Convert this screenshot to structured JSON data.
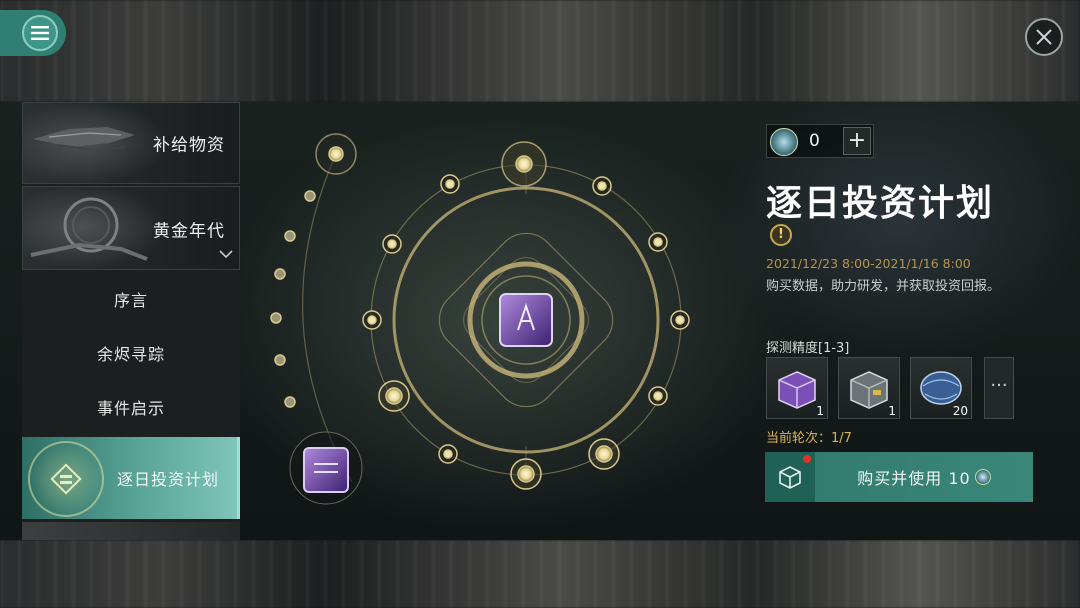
{
  "topbar": {
    "menu_icon": "hamburger-icon",
    "close_icon": "close-icon"
  },
  "sidebar": {
    "cards": [
      {
        "label": "补给物资"
      },
      {
        "label": "黄金年代",
        "expanded_icon": "chevron-down-icon"
      }
    ],
    "sub_items": [
      {
        "label": "序言"
      },
      {
        "label": "余烬寻踪"
      },
      {
        "label": "事件启示"
      },
      {
        "label": "逐日投资计划",
        "active": true
      }
    ]
  },
  "event": {
    "currency_count": "0",
    "title": "逐日投资计划",
    "date_range": "2021/12/23 8:00-2021/1/16 8:00",
    "description": "购买数据，助力研发，并获取投资回报。",
    "precision_label": "探测精度[1-3]",
    "rewards": [
      {
        "icon": "purple-crate-icon",
        "count": "1"
      },
      {
        "icon": "steel-crate-icon",
        "count": "1"
      },
      {
        "icon": "blue-orb-icon",
        "count": "20"
      }
    ],
    "more_label": "···",
    "round_label": "当前轮次：1/7",
    "buy_label": "购买并使用 10"
  },
  "colors": {
    "accent": "#327c6f",
    "gold": "#c7a94a",
    "date": "#b49552"
  }
}
